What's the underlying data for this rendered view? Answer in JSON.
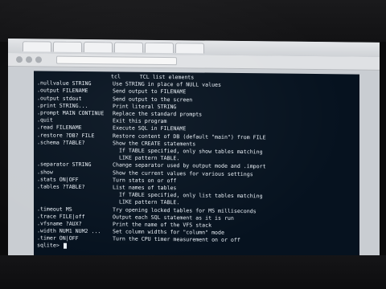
{
  "browser": {
    "tabs": [
      "",
      "",
      "",
      "",
      "",
      ""
    ],
    "address": ""
  },
  "terminal": {
    "header_cmd": "tcl",
    "header_desc": "TCL list elements",
    "rows": [
      {
        "cmd": ".nullvalue STRING",
        "desc": "Use STRING in place of NULL values"
      },
      {
        "cmd": ".output FILENAME",
        "desc": "Send output to FILENAME"
      },
      {
        "cmd": ".output stdout",
        "desc": "Send output to the screen"
      },
      {
        "cmd": ".print STRING...",
        "desc": "Print literal STRING"
      },
      {
        "cmd": ".prompt MAIN CONTINUE",
        "desc": "Replace the standard prompts"
      },
      {
        "cmd": ".quit",
        "desc": "Exit this program"
      },
      {
        "cmd": ".read FILENAME",
        "desc": "Execute SQL in FILENAME"
      },
      {
        "cmd": ".restore ?DB? FILE",
        "desc": "Restore content of DB (default \"main\") from FILE"
      },
      {
        "cmd": ".schema ?TABLE?",
        "desc": "Show the CREATE statements"
      },
      {
        "cmd": "",
        "desc": "  If TABLE specified, only show tables matching"
      },
      {
        "cmd": "",
        "desc": "  LIKE pattern TABLE."
      },
      {
        "cmd": ".separator STRING",
        "desc": "Change separator used by output mode and .import"
      },
      {
        "cmd": ".show",
        "desc": "Show the current values for various settings"
      },
      {
        "cmd": ".stats ON|OFF",
        "desc": "Turn stats on or off"
      },
      {
        "cmd": ".tables ?TABLE?",
        "desc": "List names of tables"
      },
      {
        "cmd": "",
        "desc": "  If TABLE specified, only list tables matching"
      },
      {
        "cmd": "",
        "desc": "  LIKE pattern TABLE."
      },
      {
        "cmd": ".timeout MS",
        "desc": "Try opening locked tables for MS milliseconds"
      },
      {
        "cmd": ".trace FILE|off",
        "desc": "Output each SQL statement as it is run"
      },
      {
        "cmd": ".vfsname ?AUX?",
        "desc": "Print the name of the VFS stack"
      },
      {
        "cmd": ".width NUM1 NUM2 ...",
        "desc": "Set column widths for \"column\" mode"
      },
      {
        "cmd": ".timer ON|OFF",
        "desc": "Turn the CPU timer measurement on or off"
      }
    ],
    "prompt": "sqlite> "
  }
}
